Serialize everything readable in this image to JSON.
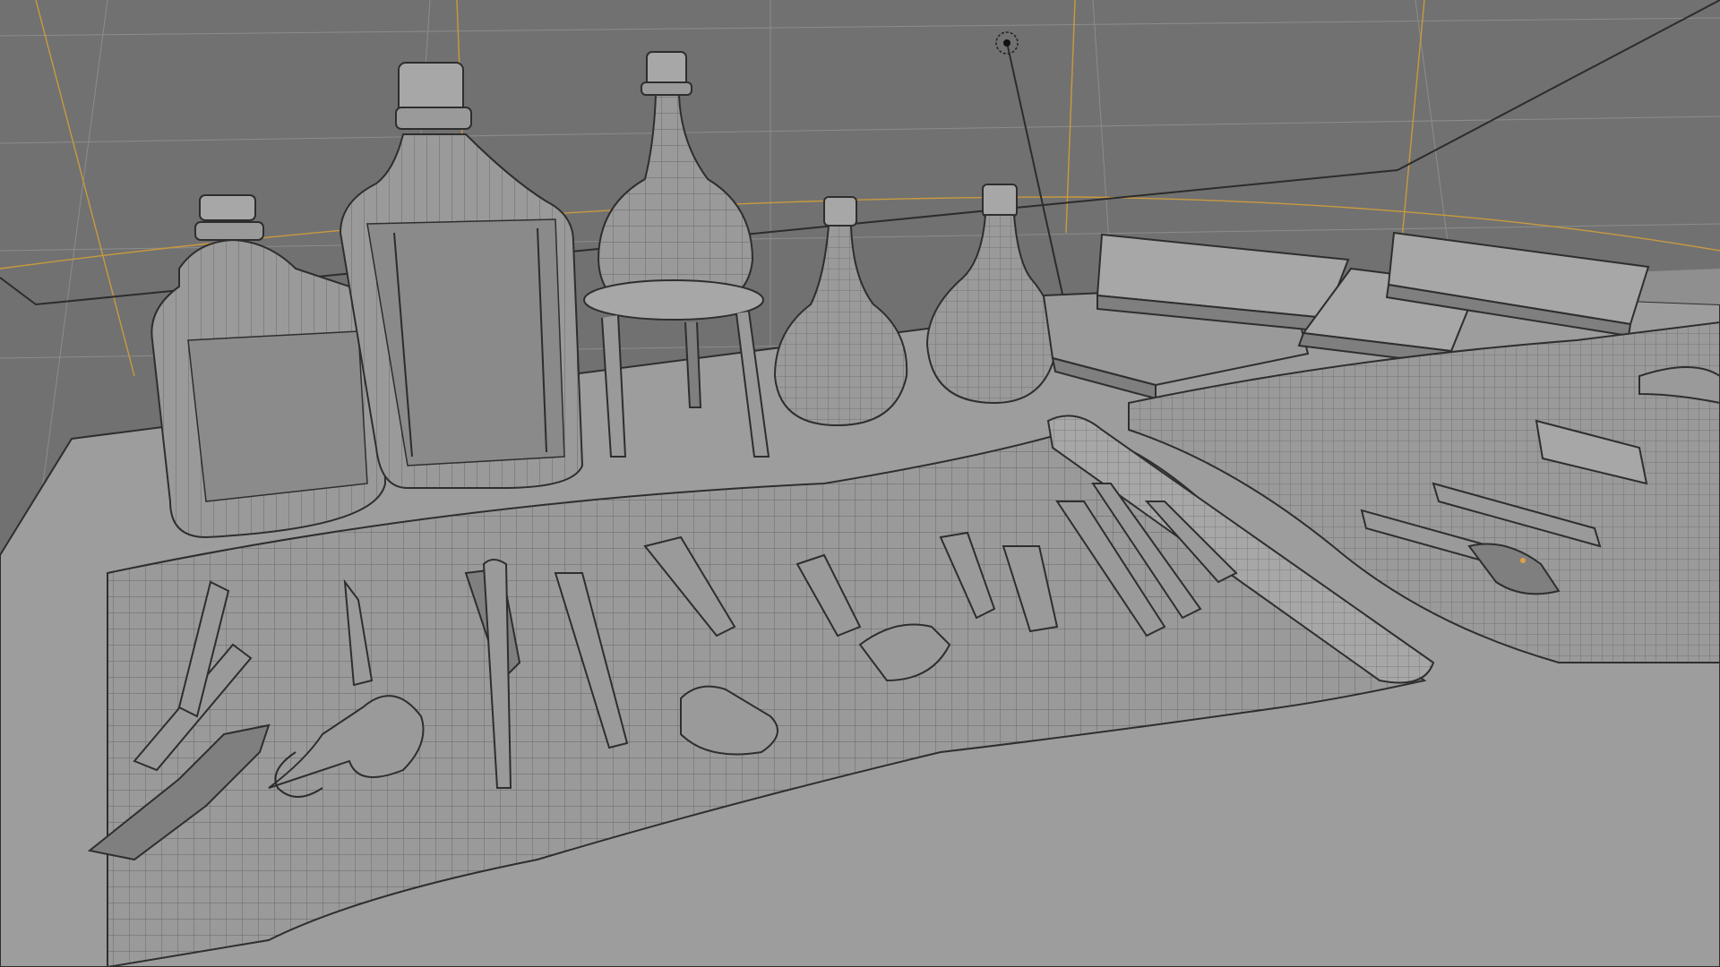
{
  "viewport": {
    "background_color": "#6f6f6f",
    "grid_color": "#8c8c8c",
    "axis_color": "#c99a3e",
    "mesh_color": "#9a9a9a",
    "wire_color": "#2e2e2e",
    "light_gizmo_icon": "light-gizmo-icon",
    "selected_vertex_color": "#e0a040"
  },
  "scene_objects": [
    "bottle-flat-left",
    "bottle-flat-tall",
    "flask-on-stand",
    "flask-small-center",
    "flask-small-right",
    "book-stack",
    "tool-roll-main",
    "tool-roll-right"
  ]
}
